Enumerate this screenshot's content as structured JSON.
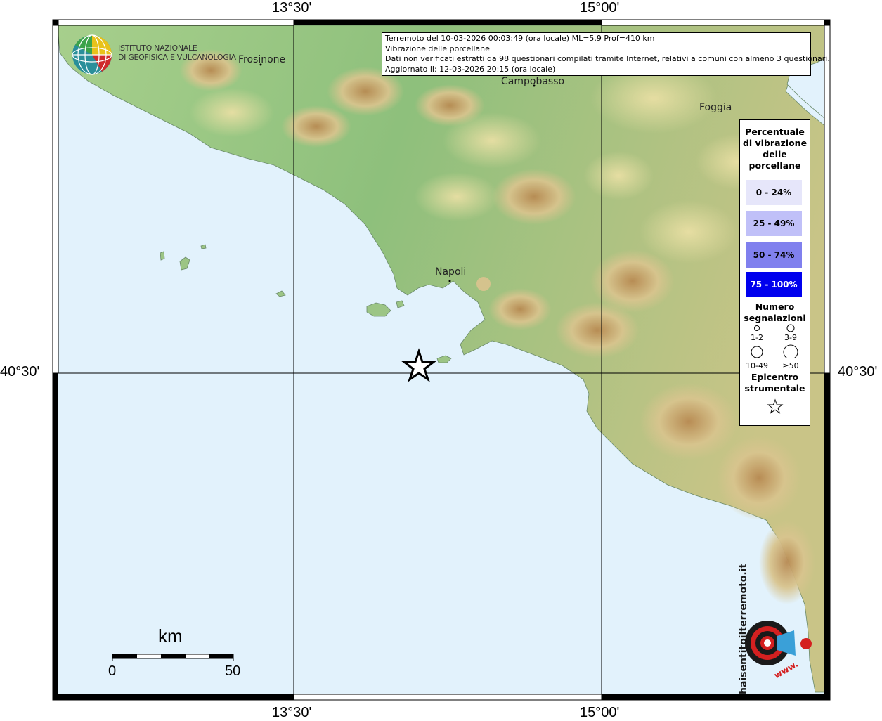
{
  "info": {
    "line1": "Terremoto del 10-03-2026 00:03:49 (ora locale) ML=5.9 Prof=410 km",
    "line2": "Vibrazione delle porcellane",
    "line3": "Dati non verificati estratti da 98 questionari compilati tramite Internet, relativi a comuni con almeno 3 questionari.",
    "line4": "Aggiornato il: 12-03-2026 20:15 (ora locale)"
  },
  "axes": {
    "lon_left": "13°30'",
    "lon_right": "15°00'",
    "lat": "40°30'"
  },
  "places": [
    "Frosinone",
    "Campobasso",
    "Foggia",
    "Napoli"
  ],
  "logo": {
    "ingv_line1": "ISTITUTO NAZIONALE",
    "ingv_line2": "DI GEOFISICA E VULCANOLOGIA",
    "hst_text": "haisentitoilterremoto.it",
    "hst_prefix": "www."
  },
  "legend": {
    "title_lines": [
      "Percentuale",
      "di vibrazione",
      "delle",
      "porcellane"
    ],
    "classes": [
      {
        "label": "0 - 24%",
        "color": "#e6e6fa",
        "text_color": "#000000"
      },
      {
        "label": "25 - 49%",
        "color": "#c0c0f8",
        "text_color": "#000000"
      },
      {
        "label": "50 - 74%",
        "color": "#8080ee",
        "text_color": "#000000"
      },
      {
        "label": "75 - 100%",
        "color": "#0000ee",
        "text_color": "#ffffff"
      }
    ],
    "count_title_1": "Numero",
    "count_title_2": "segnalazioni",
    "sizes": [
      "1-2",
      "3-9",
      "10-49",
      "≥50"
    ],
    "epi_title_1": "Epicentro",
    "epi_title_2": "strumentale"
  },
  "scale": {
    "title": "km",
    "min": "0",
    "max": "50"
  },
  "colors": {
    "sea": "#e2f2fc",
    "land_low": "#8fc07f",
    "land_mid": "#e0d49a",
    "land_high": "#b08a55"
  }
}
